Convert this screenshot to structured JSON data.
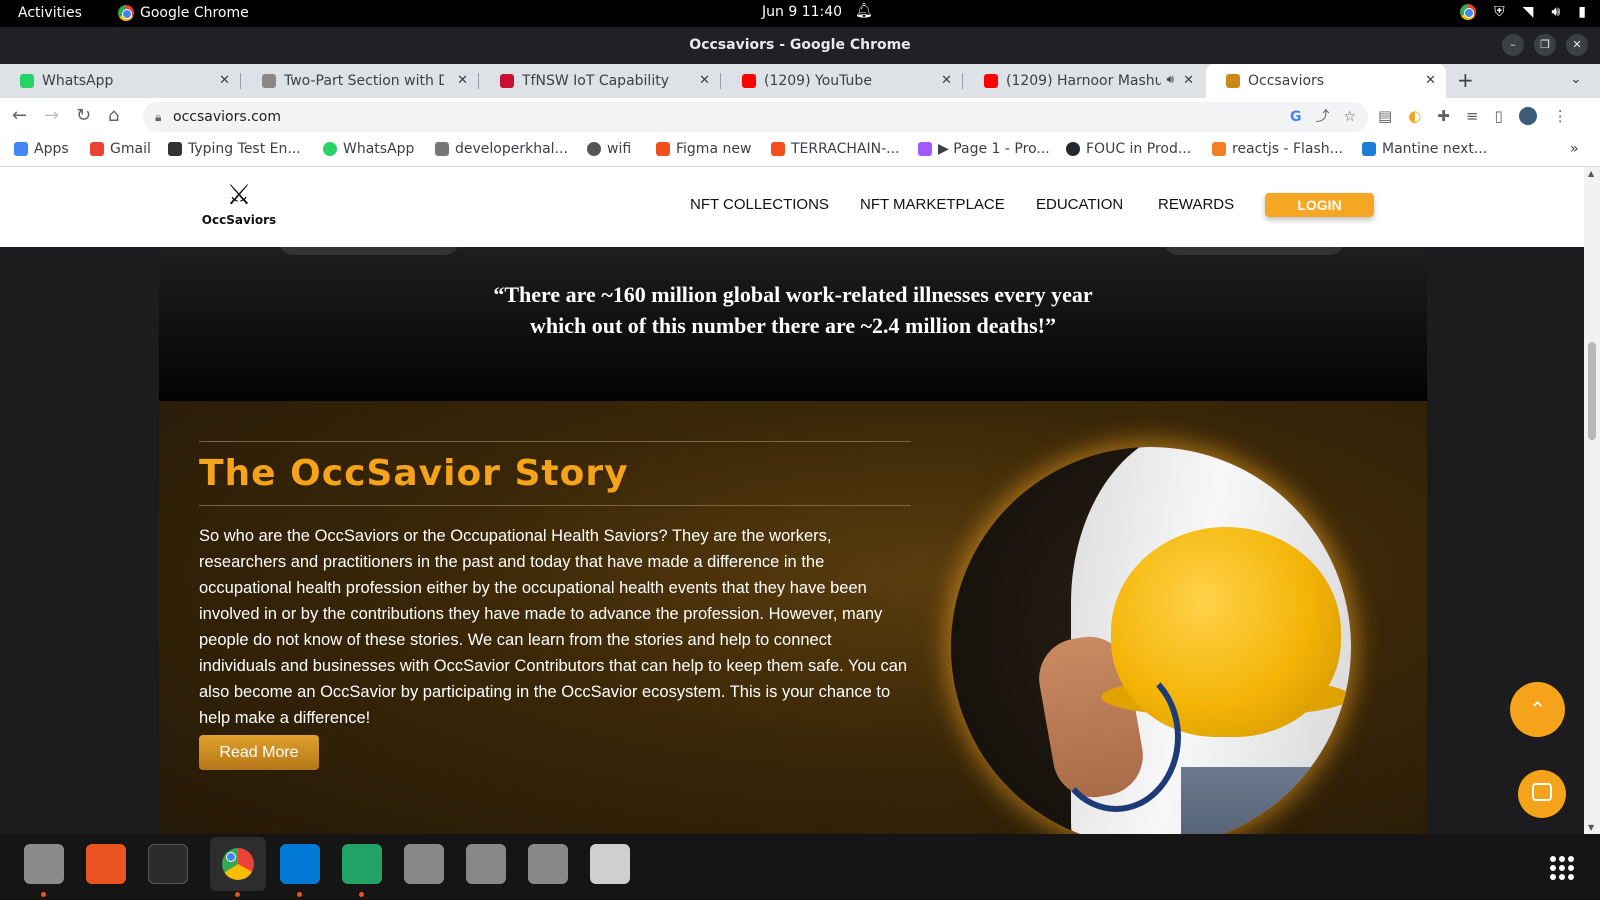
{
  "system": {
    "activities": "Activities",
    "app_name": "Google Chrome",
    "clock": "Jun 9  11:40"
  },
  "window": {
    "title": "Occsaviors - Google Chrome"
  },
  "tabs": [
    {
      "title": "WhatsApp",
      "color": "#25d366"
    },
    {
      "title": "Two-Part Section with Div",
      "color": "#888888"
    },
    {
      "title": "TfNSW IoT Capability",
      "color": "#c8102e"
    },
    {
      "title": "(1209) YouTube",
      "color": "#ff0000"
    },
    {
      "title": "(1209) Harnoor Mashu",
      "color": "#ff0000"
    },
    {
      "title": "Occsaviors",
      "color": "#c98a1a"
    }
  ],
  "omnibox": {
    "url": "occsaviors.com"
  },
  "bookmarks": [
    {
      "label": "Apps",
      "color": "#4285f4"
    },
    {
      "label": "Gmail",
      "color": "#ea4335"
    },
    {
      "label": "Typing Test En...",
      "color": "#333333"
    },
    {
      "label": "WhatsApp",
      "color": "#25d366"
    },
    {
      "label": "developerkhal...",
      "color": "#777777"
    },
    {
      "label": "wifi",
      "color": "#555555"
    },
    {
      "label": "Figma new",
      "color": "#f24e1e"
    },
    {
      "label": "TERRACHAIN-...",
      "color": "#f24e1e"
    },
    {
      "label": "▶ Page 1 - Pro...",
      "color": "#a259ff"
    },
    {
      "label": "FOUC in Prod...",
      "color": "#24292e"
    },
    {
      "label": "reactjs - Flash...",
      "color": "#f48024"
    },
    {
      "label": "Mantine next...",
      "color": "#1c7ed6"
    }
  ],
  "site": {
    "logo_text": "OccSaviors",
    "nav": [
      "NFT COLLECTIONS",
      "NFT MARKETPLACE",
      "EDUCATION",
      "REWARDS"
    ],
    "login": "LOGIN",
    "quote": "“There are ~160 million global work-related illnesses every year which out of this number there are ~2.4 million deaths!”",
    "story": {
      "heading": "The OccSavior Story",
      "body": "So who are the OccSaviors or the Occupational Health Saviors? They are the workers, researchers and practitioners in the past and today that have made a difference in the occupational health profession either by the occupational health events that they have been involved in or by the contributions they have made to advance the profession. However, many people do not know of these stories. We can learn from the stories and help to connect individuals and businesses with OccSavior Contributors that can help to keep them safe. You can also become an OccSavior by participating in the OccSavior ecosystem. This is your chance to help make a difference!",
      "button": "Read More"
    },
    "accent": "#f5a31a"
  },
  "dock": [
    {
      "name": "files",
      "color": "#8a8a8a",
      "running": true
    },
    {
      "name": "software",
      "color": "#e95420",
      "running": false
    },
    {
      "name": "terminal",
      "color": "#2c2c2c",
      "running": false
    },
    {
      "name": "chrome",
      "color": "#4285f4",
      "running": true
    },
    {
      "name": "vscode",
      "color": "#0078d4",
      "running": true
    },
    {
      "name": "spreadsheet",
      "color": "#21a366",
      "running": true
    },
    {
      "name": "disk1",
      "color": "#888888",
      "running": false
    },
    {
      "name": "disk2",
      "color": "#888888",
      "running": false
    },
    {
      "name": "disk3",
      "color": "#888888",
      "running": false
    },
    {
      "name": "trash",
      "color": "#cfcfcf",
      "running": false
    }
  ]
}
